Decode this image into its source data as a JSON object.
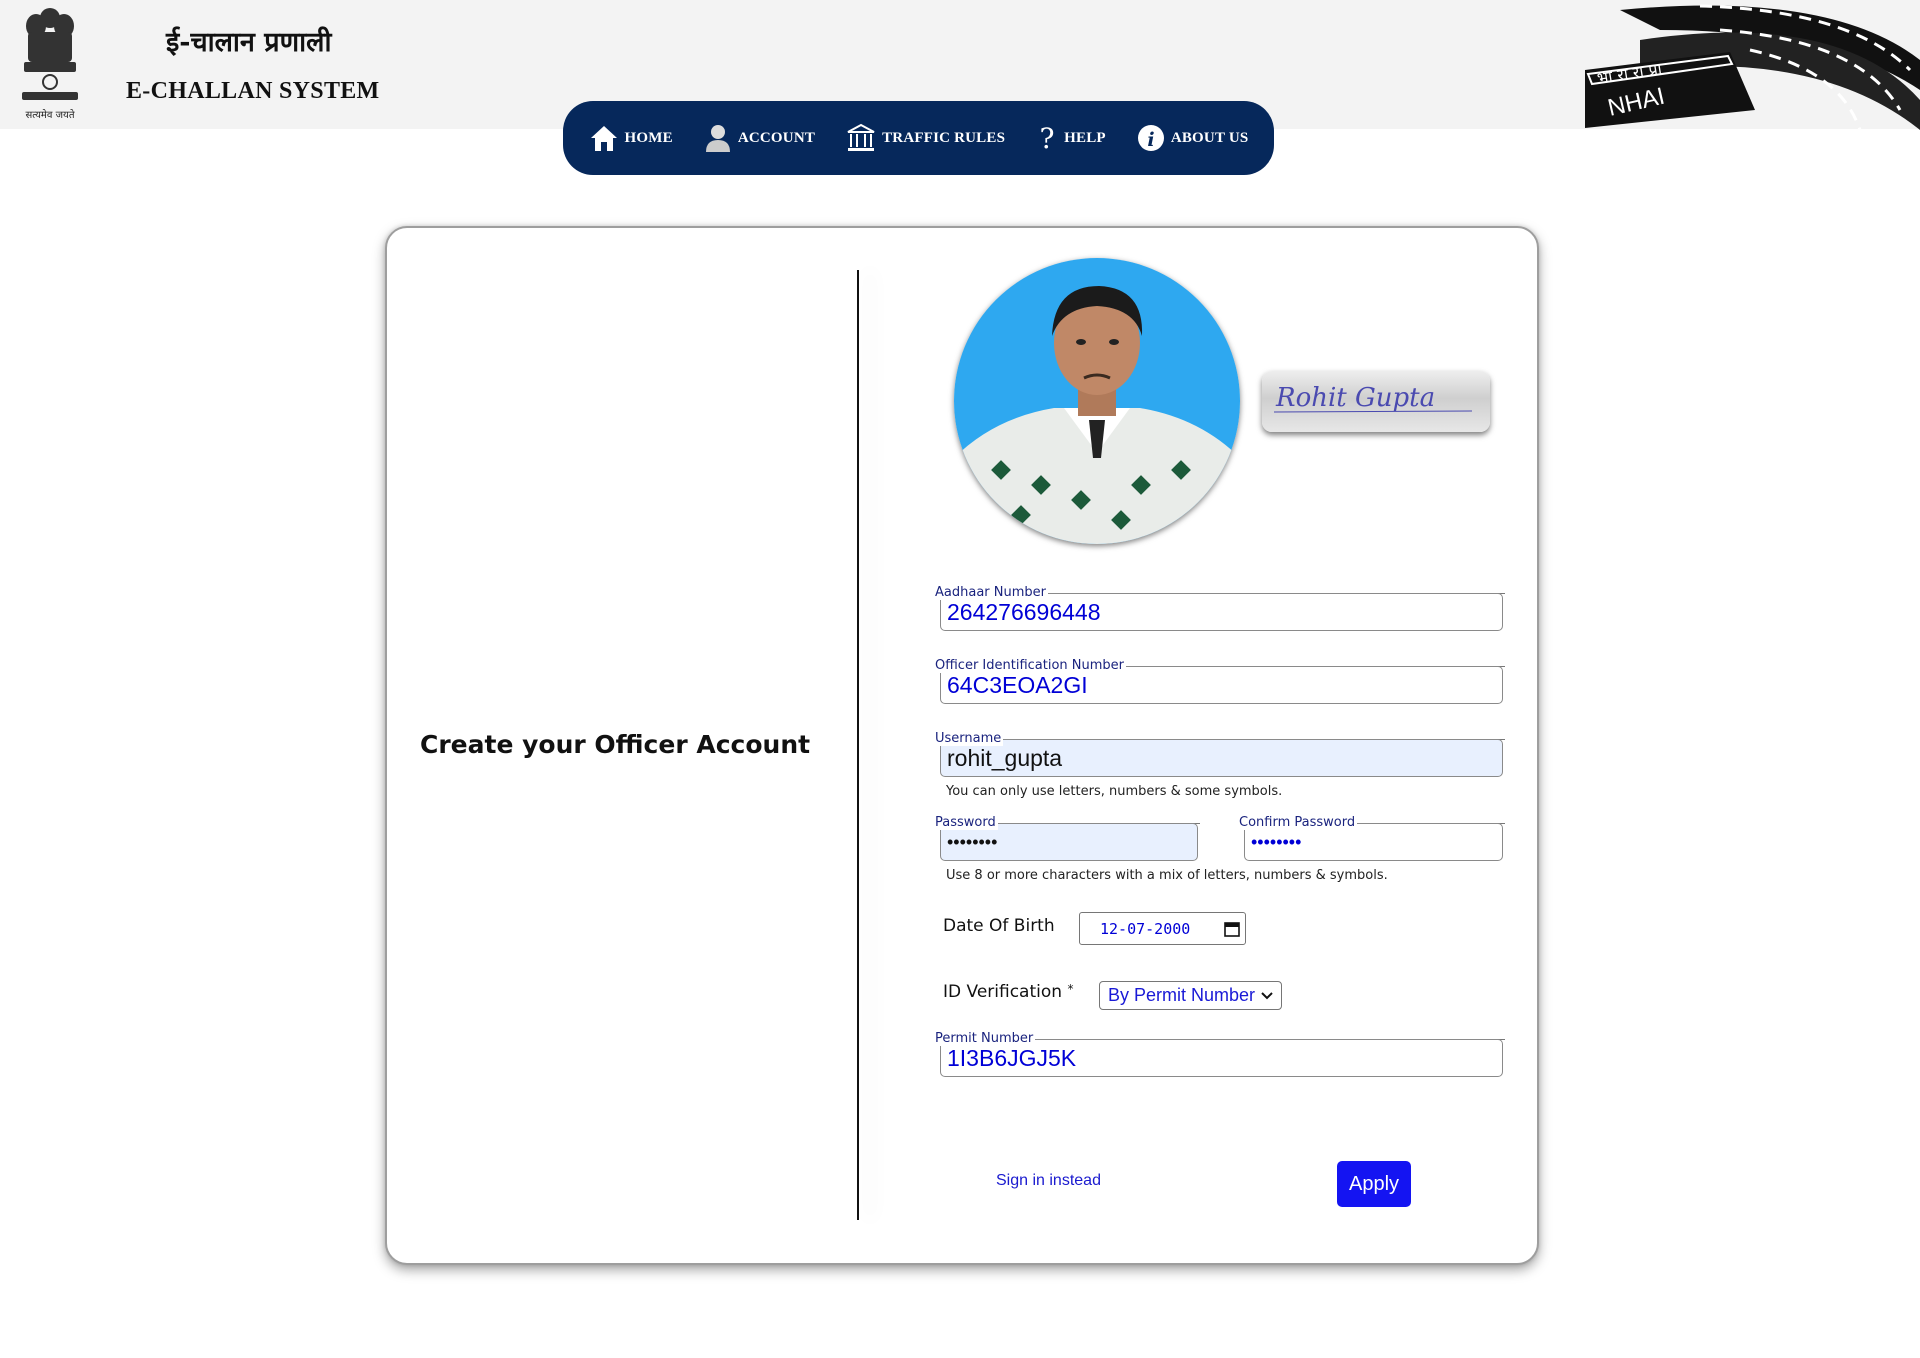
{
  "header": {
    "hindi_title": "ई-चालान प्रणाली",
    "english_title": "E-CHALLAN SYSTEM",
    "emblem_motto": "सत्यमेव जयते",
    "nhai_hindi": "भा रा रा प्रा",
    "nhai_text": "NHAI"
  },
  "nav": {
    "items": [
      {
        "label": "HOME",
        "icon": "home-icon"
      },
      {
        "label": "ACCOUNT",
        "icon": "user-icon"
      },
      {
        "label": "TRAFFIC RULES",
        "icon": "building-icon"
      },
      {
        "label": "HELP",
        "icon": "question-icon"
      },
      {
        "label": "ABOUT US",
        "icon": "info-icon"
      }
    ]
  },
  "page": {
    "title": "Create your Officer Account",
    "signature_text": "Rohit Gupta"
  },
  "form": {
    "aadhaar": {
      "label": "Aadhaar Number",
      "value": "264276696448"
    },
    "officer_id": {
      "label": "Officer Identification Number",
      "value": "64C3EOA2GI"
    },
    "username": {
      "label": "Username",
      "value": "rohit_gupta",
      "hint": "You can only use letters, numbers & some symbols."
    },
    "password": {
      "label": "Password",
      "value": "••••••••"
    },
    "confirm_password": {
      "label": "Confirm Password",
      "value": "••••••••"
    },
    "password_hint": "Use 8 or more characters with a mix of letters, numbers & symbols.",
    "dob": {
      "label": "Date Of Birth",
      "value": "12-07-2000"
    },
    "id_verification": {
      "label": "ID Verification",
      "required_mark": "*",
      "selected": "By Permit Number"
    },
    "permit": {
      "label": "Permit Number",
      "value": "1I3B6JGJ5K"
    },
    "signin_link": "Sign in instead",
    "apply_label": "Apply"
  },
  "colors": {
    "nav_bg": "#06285b",
    "apply_bg": "#1414f2",
    "input_text": "#0000d6",
    "photo_bg": "#2ea8f0"
  }
}
